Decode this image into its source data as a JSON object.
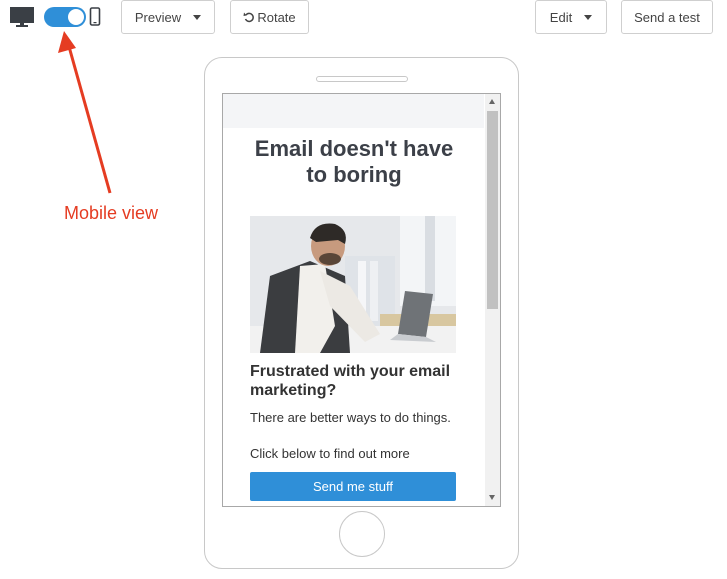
{
  "toolbar": {
    "desktop_icon": "desktop-icon",
    "mobile_icon": "mobile-phone-icon",
    "view_toggle_state": "on",
    "preview_label": "Preview",
    "rotate_label": "Rotate",
    "rotate_icon": "rotate-ccw-icon",
    "edit_label": "Edit",
    "send_test_label": "Send a test"
  },
  "email": {
    "headline": "Email doesn't have to boring",
    "subheadline": "Frustrated with your email marketing?",
    "body_line_1": "There are better ways to do things.",
    "body_line_2": "Click below to find out more",
    "cta_label": "Send me stuff"
  },
  "annotation": {
    "label": "Mobile view"
  },
  "colors": {
    "accent_blue": "#2f8fd8",
    "annotation_red": "#e53c22"
  }
}
